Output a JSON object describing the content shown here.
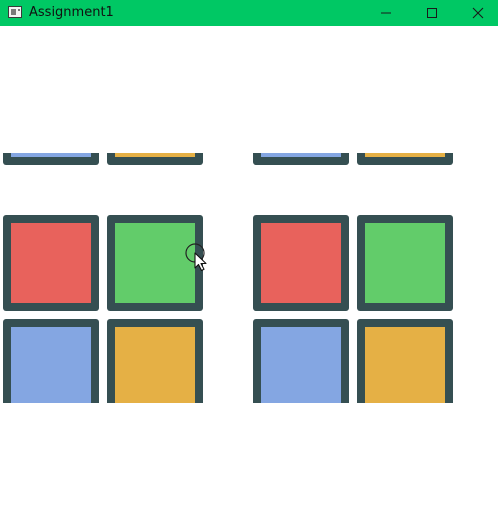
{
  "window": {
    "title": "Assignment1",
    "titlebar_color": "#00c864",
    "controls": [
      {
        "name": "minimize",
        "icon": "minimize-icon"
      },
      {
        "name": "maximize",
        "icon": "maximize-icon"
      },
      {
        "name": "close",
        "icon": "close-icon"
      }
    ]
  },
  "colors": {
    "tile_border": "#354f52",
    "red": "#e8625c",
    "green": "#62cc6a",
    "blue": "#84a6e2",
    "orange": "#e5b045"
  },
  "panels": [
    {
      "name": "left",
      "tiles": [
        {
          "row": 0,
          "col": 0,
          "color": "blue"
        },
        {
          "row": 0,
          "col": 1,
          "color": "orange"
        },
        {
          "row": 1,
          "col": 0,
          "color": "red"
        },
        {
          "row": 1,
          "col": 1,
          "color": "green"
        },
        {
          "row": 2,
          "col": 0,
          "color": "blue"
        },
        {
          "row": 2,
          "col": 1,
          "color": "orange"
        }
      ]
    },
    {
      "name": "right",
      "tiles": [
        {
          "row": 0,
          "col": 0,
          "color": "blue"
        },
        {
          "row": 0,
          "col": 1,
          "color": "orange"
        },
        {
          "row": 1,
          "col": 0,
          "color": "red"
        },
        {
          "row": 1,
          "col": 1,
          "color": "green"
        },
        {
          "row": 2,
          "col": 0,
          "color": "blue"
        },
        {
          "row": 2,
          "col": 1,
          "color": "orange"
        }
      ]
    }
  ],
  "cursor": {
    "icon": "mouse-cursor-icon"
  }
}
